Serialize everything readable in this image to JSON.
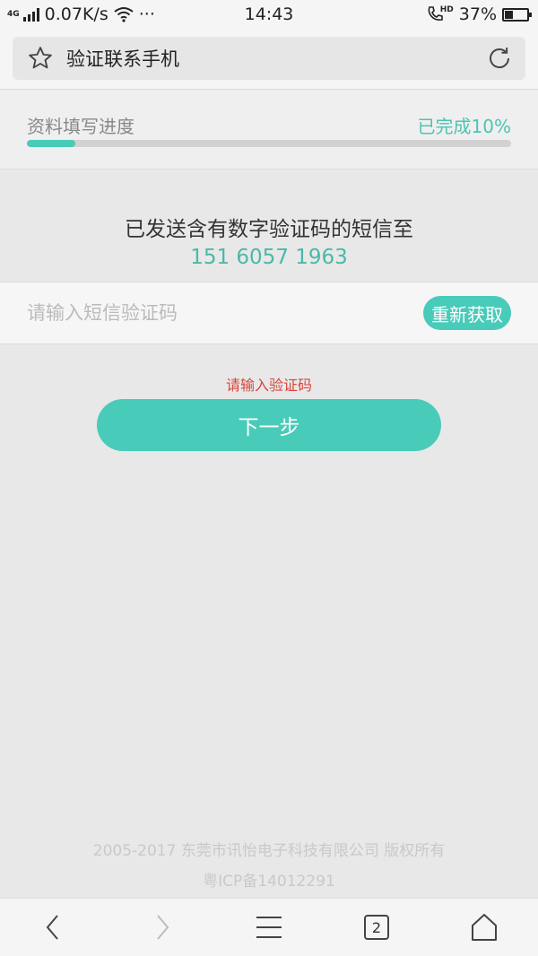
{
  "status_bar": {
    "network_type": "4G",
    "speed": "0.07K/s",
    "more": "···",
    "time": "14:43",
    "hd_label": "HD",
    "battery": "37%",
    "battery_level": 0.37
  },
  "browser": {
    "page_title": "验证联系手机",
    "icons": [
      "star-icon",
      "refresh-icon"
    ]
  },
  "progress": {
    "label": "资料填写进度",
    "status": "已完成10%",
    "value": 0.1
  },
  "message": {
    "sent_text": "已发送含有数字验证码的短信至",
    "phone": "151 6057 1963"
  },
  "code_input": {
    "value": "",
    "placeholder": "请输入短信验证码",
    "resend_label": "重新获取"
  },
  "error": "请输入验证码",
  "next_label": "下一步",
  "footer": {
    "copyright": "2005-2017 东莞市讯怡电子科技有限公司 版权所有",
    "icp": "粤ICP备14012291"
  },
  "bottom_nav": {
    "tab_count": "2",
    "icons": [
      "back-icon",
      "forward-icon",
      "menu-icon",
      "tabs-icon",
      "home-icon"
    ]
  },
  "colors": {
    "accent": "#49cbb9",
    "error": "#d9443a",
    "background": "#e8e8e8"
  }
}
